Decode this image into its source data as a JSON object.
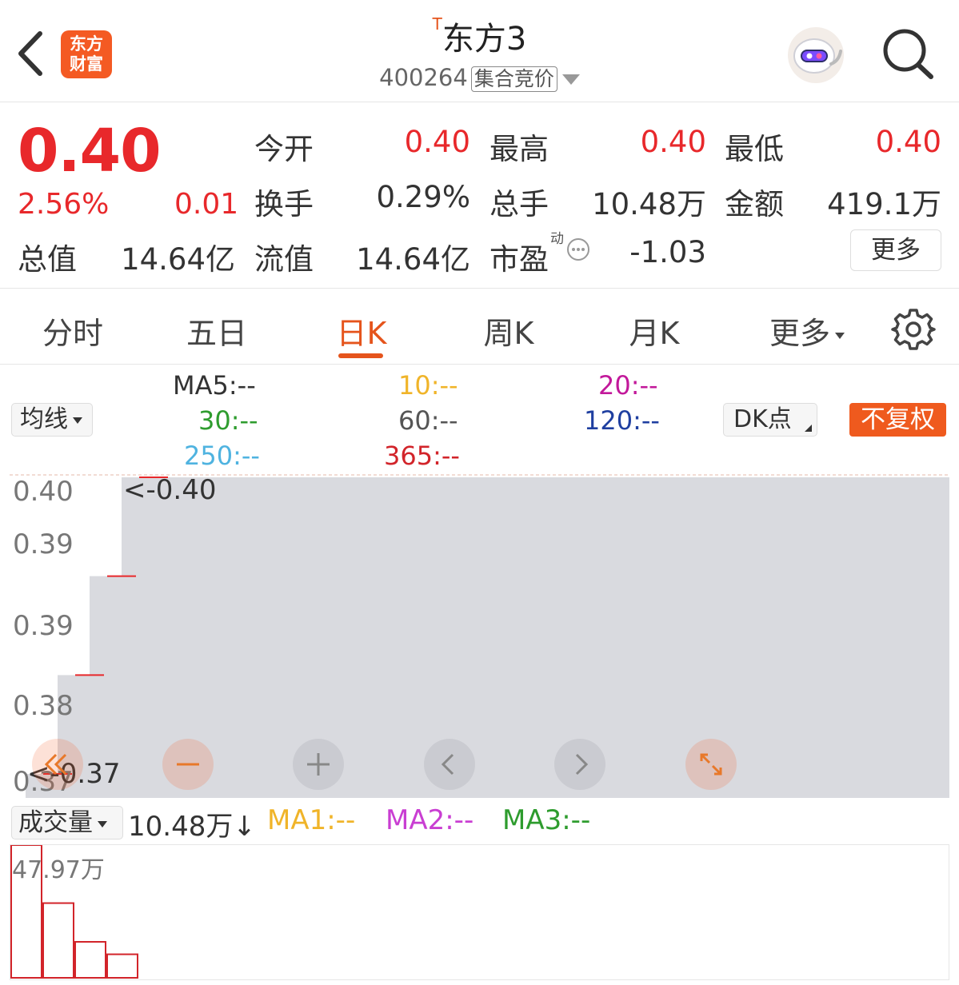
{
  "header": {
    "back_icon": "chevron-left-icon",
    "logo_line1": "东方",
    "logo_line2": "财富",
    "title_tag": "T",
    "title": "东方3",
    "code": "400264",
    "auction_badge": "集合竞价",
    "robot_icon": "robot-avatar-icon",
    "search_icon": "search-icon"
  },
  "quote": {
    "price": "0.40",
    "change_pct": "2.56%",
    "change": "0.01",
    "stats": {
      "open_label": "今开",
      "open_value": "0.40",
      "high_label": "最高",
      "high_value": "0.40",
      "low_label": "最低",
      "low_value": "0.40",
      "turnover_label": "换手",
      "turnover_value": "0.29%",
      "volume_label": "总手",
      "volume_value": "10.48万",
      "amount_label": "金额",
      "amount_value": "419.1万",
      "mktcap_label": "总值",
      "mktcap_value": "14.64亿",
      "float_label": "流值",
      "float_value": "14.64亿",
      "pe_label": "市盈",
      "pe_mark": "动",
      "pe_value": "-1.03"
    },
    "more_label": "更多"
  },
  "tabs": {
    "items": [
      "分时",
      "五日",
      "日K",
      "周K",
      "月K",
      "更多"
    ],
    "active_index": 2,
    "settings_icon": "gear-icon"
  },
  "ma": {
    "selector": "均线",
    "ma5": "MA5:--",
    "ma10": "10:--",
    "ma20": "20:--",
    "ma30": "30:--",
    "ma60": "60:--",
    "ma120": "120:--",
    "ma250": "250:--",
    "ma365": "365:--",
    "dk_label": "DK点",
    "adjust_label": "不复权",
    "colors": {
      "ma5": "#333333",
      "ma10": "#f0b429",
      "ma20": "#c2189a",
      "ma30": "#2e9c2e",
      "ma60": "#555555",
      "ma120": "#1f3fa0",
      "ma250": "#4fb3e0",
      "ma365": "#d2242a"
    }
  },
  "chart_data": {
    "type": "candlestick",
    "y_tick_labels": [
      "0.40",
      "0.39",
      "0.39",
      "0.38",
      "0.37"
    ],
    "annotation_high": "<-0.40",
    "annotation_low": "<-0.37",
    "candles": [
      {
        "open": 0.37,
        "close": 0.37,
        "high": 0.37,
        "low": 0.37
      },
      {
        "open": 0.38,
        "close": 0.38,
        "high": 0.38,
        "low": 0.38
      },
      {
        "open": 0.39,
        "close": 0.39,
        "high": 0.39,
        "low": 0.39
      },
      {
        "open": 0.4,
        "close": 0.4,
        "high": 0.4,
        "low": 0.4
      }
    ],
    "ylim": [
      0.37,
      0.4
    ],
    "controls": [
      "double-chevron-left-icon",
      "minus-icon",
      "plus-icon",
      "chevron-left-icon",
      "chevron-right-icon",
      "expand-icon"
    ],
    "volume": {
      "selector": "成交量",
      "current": "10.48万",
      "arrow": "↓",
      "ma1": "MA1:--",
      "ma2": "MA2:--",
      "ma3": "MA3:--",
      "max_label": "47.97万",
      "values": [
        47.97,
        27.0,
        13.0,
        8.5
      ],
      "unit": "万"
    }
  }
}
